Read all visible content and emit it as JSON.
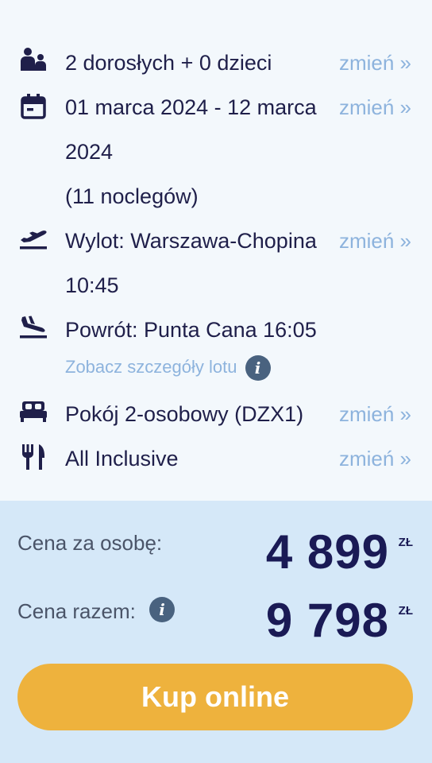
{
  "details": {
    "change_label": "zmień »",
    "guests": {
      "icon": "people-icon",
      "text": "2 dorosłych + 0 dzieci"
    },
    "dates": {
      "icon": "calendar-icon",
      "line1": "01 marca 2024 - 12 marca",
      "line2": "2024",
      "line3": "(11 noclegów)"
    },
    "departure": {
      "icon": "plane-takeoff-icon",
      "line1": "Wylot: Warszawa-Chopina",
      "line2": "10:45"
    },
    "return": {
      "icon": "plane-landing-icon",
      "line1": "Powrót: Punta Cana 16:05",
      "link": "Zobacz szczegóły lotu",
      "info_icon": "info-icon"
    },
    "room": {
      "icon": "bed-icon",
      "text": "Pokój 2-osobowy (DZX1)"
    },
    "board": {
      "icon": "cutlery-icon",
      "text": "All Inclusive"
    }
  },
  "price": {
    "per_person_label": "Cena za osobę:",
    "per_person_value": "4 899",
    "total_label": "Cena razem:",
    "total_value": "9 798",
    "currency": "ZŁ",
    "buy_label": "Kup online"
  },
  "colors": {
    "text": "#1f1f4a",
    "link": "#8db3dd",
    "price_panel": "#d5e8f8",
    "button": "#eeb23d",
    "price": "#1a1a55"
  }
}
